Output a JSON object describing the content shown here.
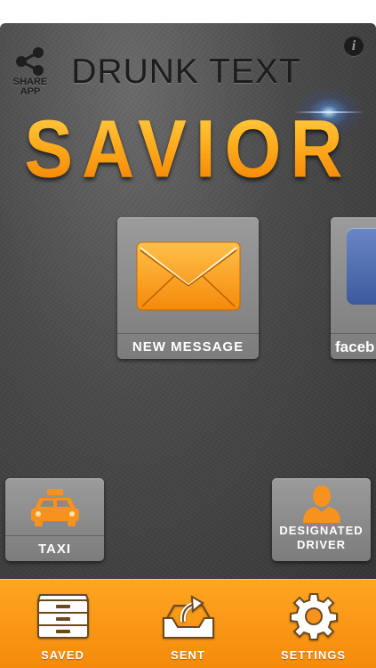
{
  "header": {
    "share_label": "SHARE APP",
    "info_glyph": "i",
    "title_top": "DRUNK TEXT",
    "title_main": "SAVIOR"
  },
  "tiles": {
    "new_message": {
      "label": "NEW MESSAGE",
      "icon": "envelope-icon"
    },
    "facebook": {
      "label": "faceb",
      "icon": "facebook-icon"
    },
    "taxi": {
      "label": "TAXI",
      "icon": "taxi-icon"
    },
    "designated_driver": {
      "label": "DESIGNATED DRIVER",
      "icon": "driver-icon"
    }
  },
  "tabbar": {
    "items": [
      {
        "label": "SAVED",
        "icon": "drawer-icon"
      },
      {
        "label": "SENT",
        "icon": "outbox-icon"
      },
      {
        "label": "SETTINGS",
        "icon": "gear-icon"
      }
    ]
  },
  "colors": {
    "accent": "#f7921e",
    "background": "#484848",
    "tile": "#8a8a8a"
  }
}
